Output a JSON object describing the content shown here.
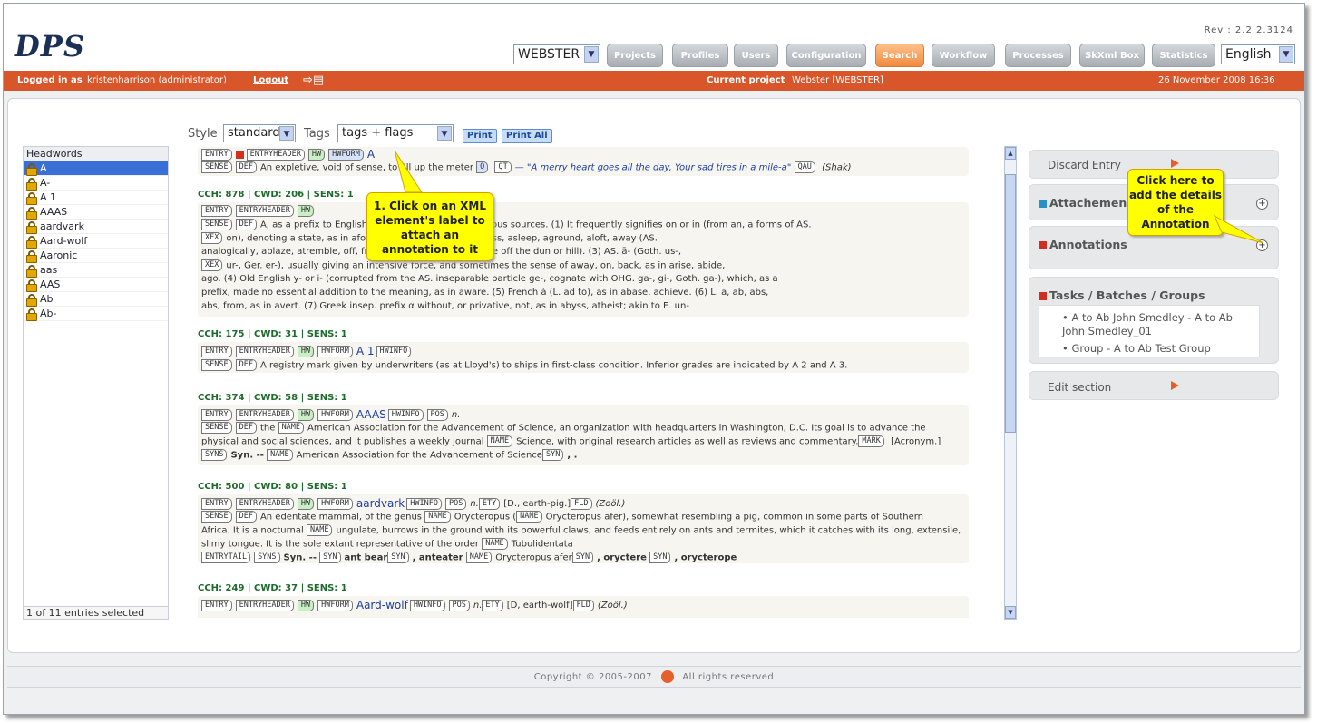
{
  "header": {
    "logo": "DPS",
    "rev": "Rev : 2.2.2.3124",
    "dictionary": "WEBSTER",
    "language": "English",
    "nav": [
      "Projects",
      "Profiles",
      "Users",
      "Configuration",
      "Search",
      "Workflow",
      "Processes",
      "SkXml Box",
      "Statistics"
    ]
  },
  "status": {
    "logged_label": "Logged in as",
    "user": "kristenharrison (administrator)",
    "logout": "Logout",
    "project_label": "Current project",
    "project": "Webster [WEBSTER]",
    "date": "26 November 2008 16:36"
  },
  "toolbar": {
    "style_label": "Style",
    "style_value": "standard",
    "tags_label": "Tags",
    "tags_value": "tags + flags",
    "print": "Print",
    "print_all": "Print All"
  },
  "headwords": {
    "title": "Headwords",
    "items": [
      "A",
      "A-",
      "A 1",
      "AAAS",
      "aardvark",
      "Aard-wolf",
      "Aaronic",
      "aas",
      "AAS",
      "Ab",
      "Ab-"
    ],
    "footer": "1 of 11 entries selected"
  },
  "entries": {
    "e1": {
      "hw": "A",
      "l2a": "An expletive, void of sense, to fill up the meter",
      "l2q": "— \"A merry heart goes all the day, Your sad tires in a mile-a\"",
      "l2s": "(Shak)"
    },
    "e2": {
      "cch": "CCH: 878  |  CWD: 206  |  SENS: 1",
      "lines": [
        "A, as a prefix to English words, is derived from various sources. (1) It frequently signifies on or in (from an, a forms of AS.",
        "on), denoting a state, as in afoot, abed, aloud, asleep, amiss, asleep, aground, aloft, away (AS.",
        "analogically, ablaze, atremble, off, from, as in adown (AS. ofdūne off the dun or hill). (3) AS. ā- (Goth. us-,",
        "ur-, Ger. er-), usually giving an intensive force, and sometimes the sense of away, on, back, as in arise, abide,",
        "ago. (4) Old English y- or i- (corrupted from the AS. inseparable particle ge-, cognate with OHG. ga-, gi-, Goth. ga-), which, as a",
        "prefix, made no essential addition to the meaning, as in aware. (5) French à (L. ad to), as in abase, achieve. (6) L. a, ab, abs,",
        "abs, from, as in avert. (7) Greek insep. prefix α without, or privative, not, as in abyss, atheist; akin to E. un-"
      ]
    },
    "e3": {
      "cch": "CCH: 175  |  CWD: 31  |  SENS: 1",
      "hw": "A 1",
      "def": "A registry mark given by underwriters (as at Lloyd's) to ships in first-class condition. Inferior grades are indicated by A 2 and A 3."
    },
    "e4": {
      "cch": "CCH: 374  |  CWD: 58  |  SENS: 1",
      "hw": "AAAS",
      "pos": "n.",
      "l2a": "the",
      "l2b": "American Association for the Advancement of Science, an organization with headquarters in Washington, D.C. Its goal is to advance the",
      "l3": "physical and social sciences, and it publishes a weekly journal",
      "l3b": "Science, with original research articles as well as reviews and commentary.",
      "l3c": "[Acronym.]",
      "syn": "Syn. --",
      "synv": "American Association for the Advancement of Science"
    },
    "e5": {
      "cch": "CCH: 500  |  CWD: 80  |  SENS: 1",
      "hw": "aardvark",
      "pos": "n.",
      "ety": "[D., earth-pig.]",
      "fld": "(Zoöl.)",
      "l2a": "An edentate mammal, of the genus",
      "l2b": "Orycteropus (",
      "l2c": "Orycteropus afer), somewhat resembling a pig, common in some parts of Southern",
      "l3": "Africa. It is a nocturnal",
      "l3b": "ungulate, burrows in the ground with its powerful claws, and feeds entirely on ants and termites, which it catches with its long, extensile,",
      "l4": "slimy tongue. It is the sole extant representative of the order",
      "l4b": "Tubulidentata",
      "syn": "Syn. --",
      "s1": "ant bear",
      "s2": ", anteater",
      "s3": "Orycteropus afer",
      "s4": ", orycterе",
      "s5": ", orycterope"
    },
    "e6": {
      "cch": "CCH: 249  |  CWD: 37  |  SENS: 1",
      "hw": "Aard-wolf",
      "ety": "[D, earth-wolf]",
      "fld": "(Zoöl.)"
    }
  },
  "right": {
    "discard": "Discard Entry",
    "attach": "Attachements",
    "annot": "Annotations",
    "tasks": "Tasks / Batches / Groups",
    "task_items": [
      "A to Ab John Smedley - A to Ab John Smedley_01",
      "Group - A to Ab Test Group"
    ],
    "edit": "Edit section"
  },
  "callouts": {
    "c1": "1. Click on an XML element's label to attach an annotation to it",
    "c2": "Click here to add the details of the Annotation"
  },
  "footer": {
    "copyright": "Copyright © 2005-2007",
    "rights": "All rights reserved"
  },
  "colors": {
    "accent": "#d9552a",
    "nav_active": "#f08a3e",
    "link": "#1e3ea0"
  }
}
